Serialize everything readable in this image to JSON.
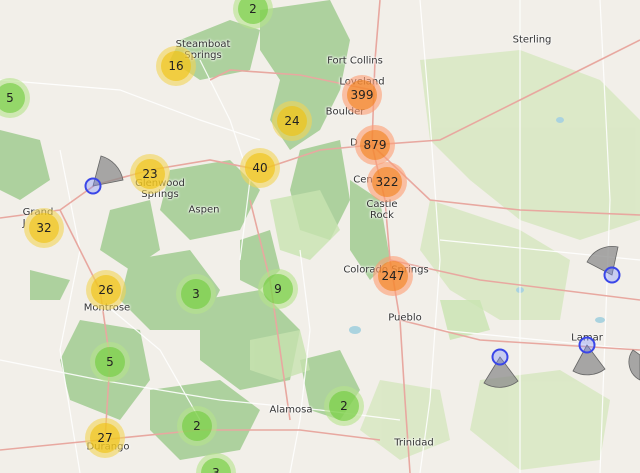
{
  "colors": {
    "land": "#f2efe9",
    "forest": "#add19e",
    "forest_dark": "#8fbf7f",
    "park": "#c8e3b0",
    "road_major": "#e8a8a0",
    "road_minor": "#ffffff",
    "water": "#aad3df",
    "cluster_small_outer": "rgba(181,226,140,0.6)",
    "cluster_small_inner": "rgba(110,204,57,0.6)",
    "cluster_medium_outer": "rgba(241,211,87,0.6)",
    "cluster_medium_inner": "rgba(240,194,12,0.6)",
    "cluster_large_outer": "rgba(253,156,115,0.6)",
    "cluster_large_inner": "rgba(241,128,23,0.6)",
    "marker": "#3a46e8",
    "sector": "#8c8c8c"
  },
  "cities": [
    {
      "id": "steamboat-springs",
      "label": "Steamboat\nSprings"
    },
    {
      "id": "fort-collins",
      "label": "Fort Collins"
    },
    {
      "id": "sterling",
      "label": "Sterling"
    },
    {
      "id": "loveland",
      "label": "Loveland"
    },
    {
      "id": "boulder",
      "label": "Boulder"
    },
    {
      "id": "denver",
      "label": "D"
    },
    {
      "id": "centennial",
      "label": "Cen"
    },
    {
      "id": "castle-rock",
      "label": "Castle\nRock"
    },
    {
      "id": "glenwood-springs",
      "label": "Glenwood\nSprings"
    },
    {
      "id": "aspen",
      "label": "Aspen"
    },
    {
      "id": "grand-junction",
      "label": "Grand\nJ"
    },
    {
      "id": "colorado-springs",
      "label": "Colorado Springs"
    },
    {
      "id": "montrose",
      "label": "Montrose"
    },
    {
      "id": "pueblo",
      "label": "Pueblo"
    },
    {
      "id": "lamar",
      "label": "Lamar"
    },
    {
      "id": "alamosa",
      "label": "Alamosa"
    },
    {
      "id": "trinidad",
      "label": "Trinidad"
    },
    {
      "id": "durango",
      "label": "Durango"
    }
  ],
  "clusters": [
    {
      "id": "north-park",
      "count": "2",
      "tier": "small"
    },
    {
      "id": "west-edge",
      "count": "5",
      "tier": "small"
    },
    {
      "id": "steamboat",
      "count": "16",
      "tier": "medium"
    },
    {
      "id": "loveland",
      "count": "399",
      "tier": "large"
    },
    {
      "id": "nederland",
      "count": "24",
      "tier": "medium"
    },
    {
      "id": "denver",
      "count": "879",
      "tier": "large"
    },
    {
      "id": "summit",
      "count": "40",
      "tier": "medium"
    },
    {
      "id": "glenwood",
      "count": "23",
      "tier": "medium"
    },
    {
      "id": "castle-rock",
      "count": "322",
      "tier": "large"
    },
    {
      "id": "grand-junction",
      "count": "32",
      "tier": "medium"
    },
    {
      "id": "colorado-springs",
      "count": "247",
      "tier": "large"
    },
    {
      "id": "montrose",
      "count": "26",
      "tier": "medium"
    },
    {
      "id": "gunnison",
      "count": "3",
      "tier": "small"
    },
    {
      "id": "salida",
      "count": "9",
      "tier": "small"
    },
    {
      "id": "telluride",
      "count": "5",
      "tier": "small"
    },
    {
      "id": "alamosa",
      "count": "2",
      "tier": "small"
    },
    {
      "id": "creede",
      "count": "2",
      "tier": "small"
    },
    {
      "id": "durango",
      "count": "27",
      "tier": "medium"
    },
    {
      "id": "south-edge",
      "count": "3",
      "tier": "small"
    }
  ],
  "markers": [
    {
      "id": "grand-junction-east"
    },
    {
      "id": "east-edge"
    },
    {
      "id": "las-animas"
    },
    {
      "id": "lamar"
    }
  ]
}
